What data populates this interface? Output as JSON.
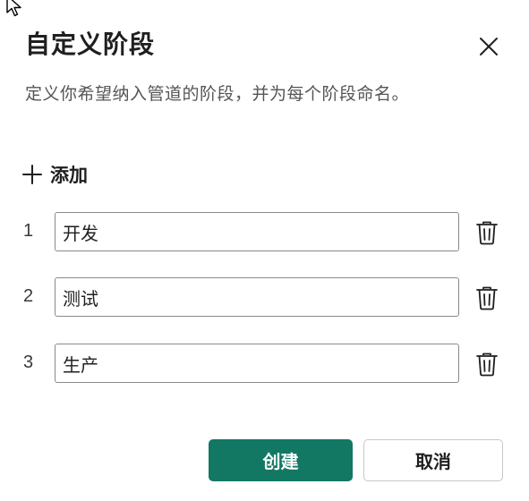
{
  "dialog": {
    "title": "自定义阶段",
    "description": "定义你希望纳入管道的阶段，并为每个阶段命名。",
    "close_icon": "close-icon"
  },
  "add": {
    "label": "添加",
    "icon": "plus-icon"
  },
  "stages": [
    {
      "number": "1",
      "value": "开发",
      "delete_icon": "trash-icon"
    },
    {
      "number": "2",
      "value": "测试",
      "delete_icon": "trash-icon"
    },
    {
      "number": "3",
      "value": "生产",
      "delete_icon": "trash-icon"
    }
  ],
  "footer": {
    "create_label": "创建",
    "cancel_label": "取消"
  },
  "colors": {
    "primary": "#137863",
    "text": "#1f1f1f",
    "muted": "#555555",
    "border": "#8a8a8a"
  }
}
